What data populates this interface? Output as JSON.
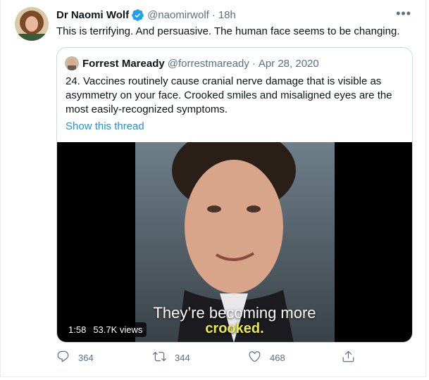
{
  "tweet": {
    "author_name": "Dr Naomi Wolf",
    "handle": "@naomirwolf",
    "separator": "·",
    "time": "18h",
    "more_label": "•••",
    "text": "This is terrifying. And persuasive. The human face seems to be changing."
  },
  "quote": {
    "author_name": "Forrest Maready",
    "handle": "@forrestmaready",
    "separator": "·",
    "date": "Apr 28, 2020",
    "text": "24. Vaccines routinely cause cranial nerve damage that is visible as asymmetry on your face. Crooked smiles and misaligned eyes are the most easily-recognized symptoms.",
    "show_thread": "Show this thread",
    "video": {
      "caption_line1": "They’re becoming more",
      "caption_line2": "crooked.",
      "duration": "1:58",
      "views": "53.7K views"
    }
  },
  "actions": {
    "replies": "364",
    "retweets": "344",
    "likes": "468"
  },
  "colors": {
    "verified": "#1da1f2",
    "link": "#1b95e0",
    "muted": "#5b7083",
    "caption_highlight": "#e8ea45"
  },
  "icons": [
    "verified-badge-icon",
    "more-icon",
    "reply-icon",
    "retweet-icon",
    "like-icon",
    "share-icon"
  ]
}
